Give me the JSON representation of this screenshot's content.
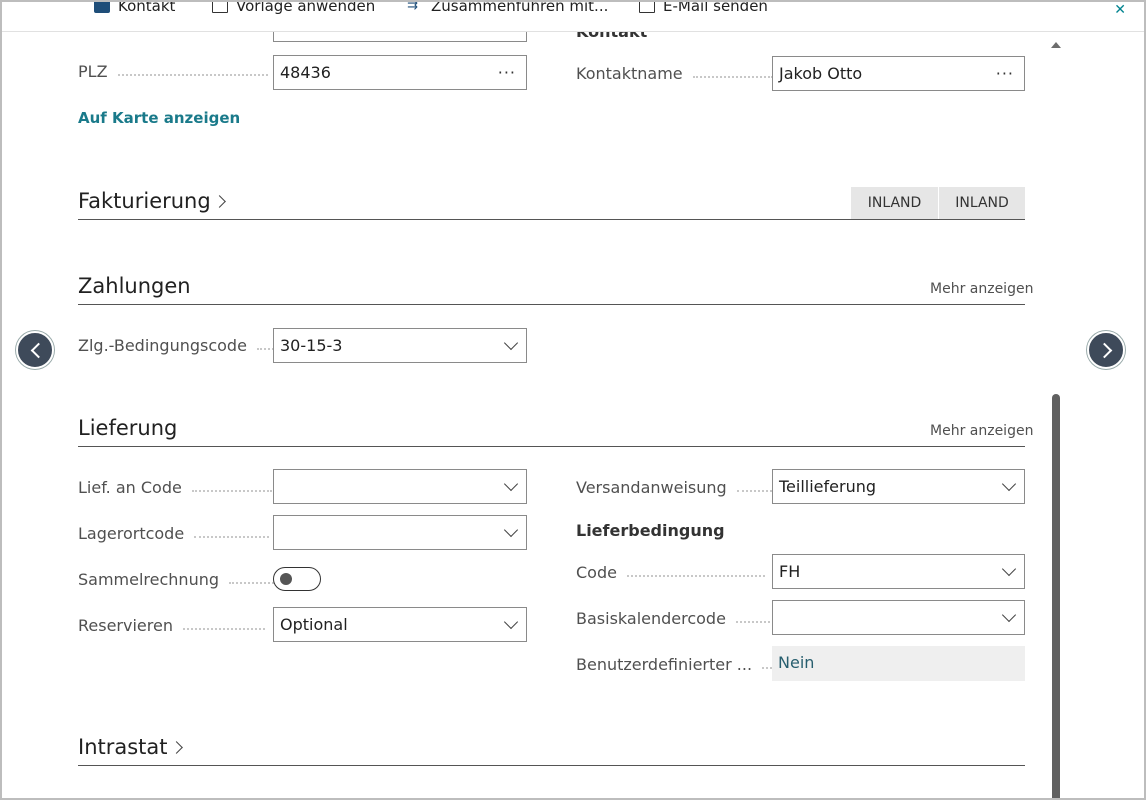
{
  "actions": {
    "contact": "Kontakt",
    "template": "Vorlage anwenden",
    "merge": "Zusammenführen mit...",
    "email": "E-Mail senden"
  },
  "address": {
    "postcode_label": "PLZ",
    "postcode_value": "48436",
    "map_link": "Auf Karte anzeigen"
  },
  "contact": {
    "heading": "Kontakt",
    "name_label": "Kontaktname",
    "name_value": "Jakob Otto"
  },
  "invoicing": {
    "title": "Fakturierung",
    "badge1": "INLAND",
    "badge2": "INLAND"
  },
  "payments": {
    "title": "Zahlungen",
    "more": "Mehr anzeigen",
    "terms_label": "Zlg.-Bedingungscode",
    "terms_value": "30-15-3"
  },
  "shipping": {
    "title": "Lieferung",
    "more": "Mehr anzeigen",
    "shipto_label": "Lief. an Code",
    "shipto_value": "",
    "location_label": "Lagerortcode",
    "location_value": "",
    "combine_label": "Sammelrechnung",
    "reserve_label": "Reservieren",
    "reserve_value": "Optional",
    "advice_label": "Versandanweisung",
    "advice_value": "Teillieferung",
    "terms_heading": "Lieferbedingung",
    "code_label": "Code",
    "code_value": "FH",
    "calendar_label": "Basiskalendercode",
    "calendar_value": "",
    "custom_label": "Benutzerdefinierter ...",
    "custom_value": "Nein"
  },
  "intrastat": {
    "title": "Intrastat"
  },
  "colors": {
    "accent": "#1a7a8a",
    "nav": "#3e4a5a"
  }
}
